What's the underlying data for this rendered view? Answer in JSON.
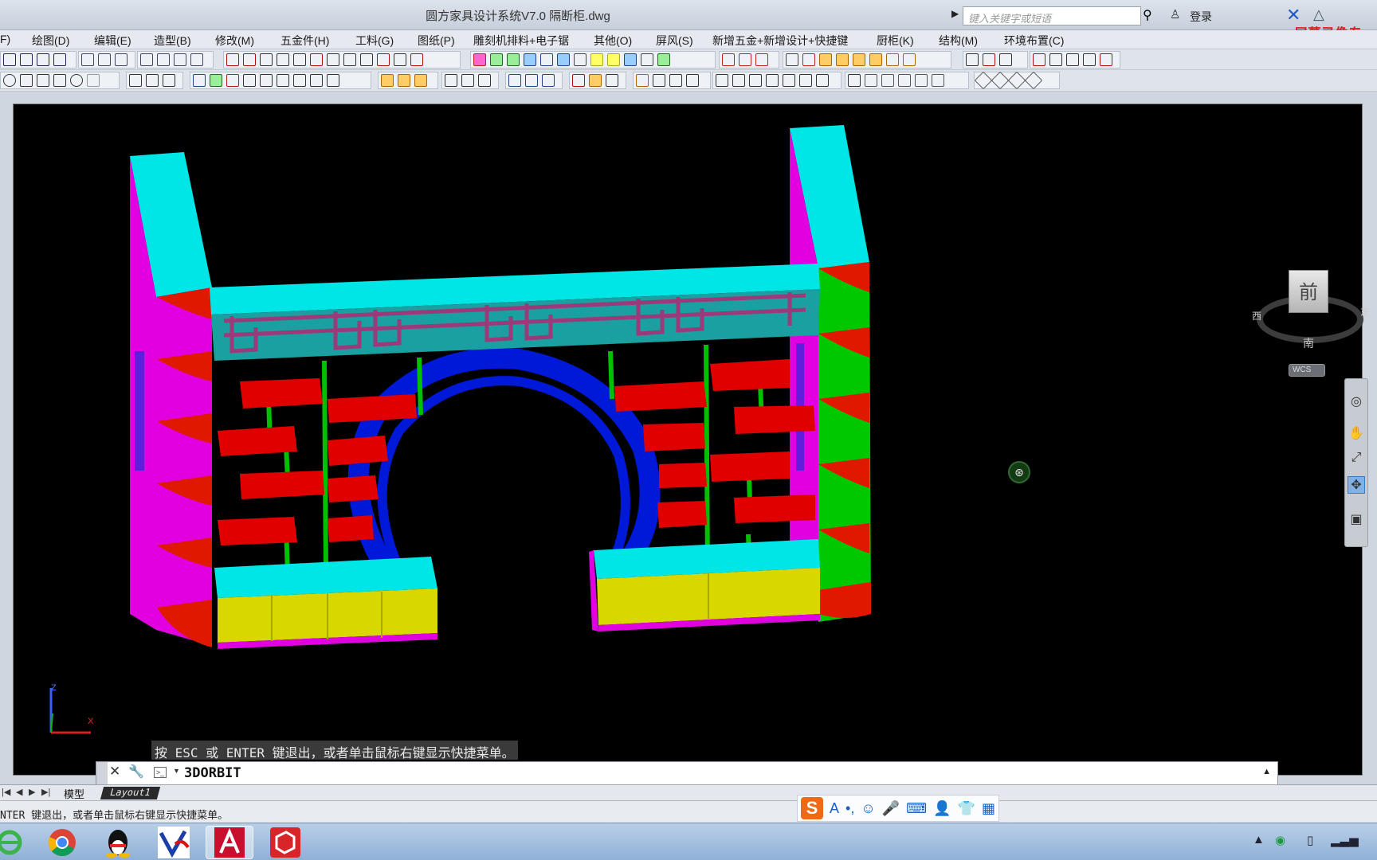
{
  "window": {
    "title": "圆方家具设计系统V7.0    隔断柜.dwg"
  },
  "header": {
    "search_placeholder": "键入关键字或短语",
    "login_label": "登录",
    "watermark": "屏幕录像专"
  },
  "menu": [
    {
      "label": "F)"
    },
    {
      "label": "绘图(D)"
    },
    {
      "label": "编辑(E)"
    },
    {
      "label": "造型(B)"
    },
    {
      "label": "修改(M)"
    },
    {
      "label": "五金件(H)"
    },
    {
      "label": "工料(G)"
    },
    {
      "label": "图纸(P)"
    },
    {
      "label": "雕刻机排料+电子锯"
    },
    {
      "label": "其他(O)"
    },
    {
      "label": "屏风(S)"
    },
    {
      "label": "新增五金+新增设计+快捷键"
    },
    {
      "label": "厨柜(K)"
    },
    {
      "label": "结构(M)"
    },
    {
      "label": "环境布置(C)"
    }
  ],
  "viewcube": {
    "face": "前",
    "south": "南",
    "west": "西",
    "east": "东",
    "wcs": "WCS"
  },
  "ucs": {
    "z": "Z",
    "x": "X"
  },
  "command": {
    "hint": "按 ESC 或 ENTER 键退出，或者单击鼠标右键显示快捷菜单。",
    "current": "3DORBIT"
  },
  "layout_tabs": {
    "model": "模型",
    "layout1": "Layout1"
  },
  "status": {
    "text": "NTER 键退出，或者单击鼠标右键显示快捷菜单。"
  },
  "ime": {
    "logo": "S"
  },
  "taskbar": {
    "apps": [
      "ie-icon",
      "chrome-icon",
      "qq-icon",
      "yuanfang-icon",
      "autocad-icon",
      "sketchup-icon"
    ],
    "active": "autocad-icon"
  },
  "colors": {
    "cyan": "#00e5e5",
    "magenta": "#e000e0",
    "red": "#e00000",
    "green": "#00d000",
    "yellow": "#d8d800",
    "blue": "#0018d8",
    "lattice": "#9a3a7a"
  }
}
